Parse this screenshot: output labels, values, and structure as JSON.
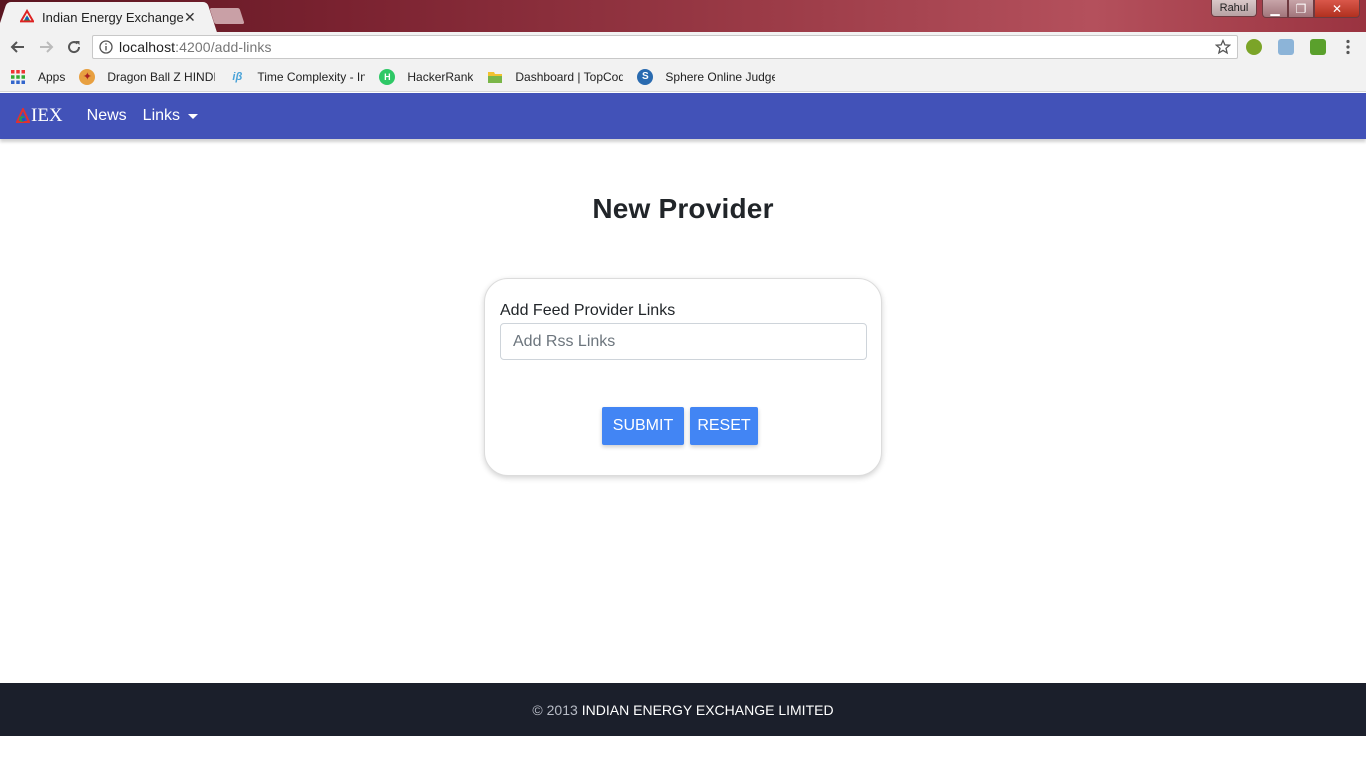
{
  "browser": {
    "tab_title": "Indian Energy Exchange",
    "tab_close": "✕",
    "profile_name": "Rahul",
    "window_controls": {
      "minimize": "▁",
      "maximize": "❐",
      "close": "✕"
    },
    "url_host": "localhost",
    "url_path": ":4200/add-links",
    "bookmarks": [
      {
        "label": "Apps",
        "icon": "apps-grid-icon"
      },
      {
        "label": "Dragon Ball Z HINDI",
        "icon": "dragon-ball-icon"
      },
      {
        "label": "Time Complexity - In",
        "icon": "ib-icon"
      },
      {
        "label": "HackerRank",
        "icon": "hackerrank-icon"
      },
      {
        "label": "Dashboard | TopCod",
        "icon": "topcoder-icon"
      },
      {
        "label": "Sphere Online Judge",
        "icon": "spoj-icon"
      }
    ]
  },
  "navbar": {
    "brand": "IEX",
    "links": [
      {
        "label": "News"
      },
      {
        "label": "Links",
        "dropdown": true
      }
    ]
  },
  "main": {
    "title": "New Provider",
    "form": {
      "label": "Add Feed Provider Links",
      "input_placeholder": "Add Rss Links",
      "input_value": "",
      "submit_label": "SUBMIT",
      "reset_label": "RESET"
    }
  },
  "footer": {
    "copyright": "© 2013",
    "company": "INDIAN ENERGY EXCHANGE LIMITED"
  },
  "colors": {
    "navbar": "#4252b8",
    "button": "#4285f4",
    "footer": "#1b1f2b"
  }
}
